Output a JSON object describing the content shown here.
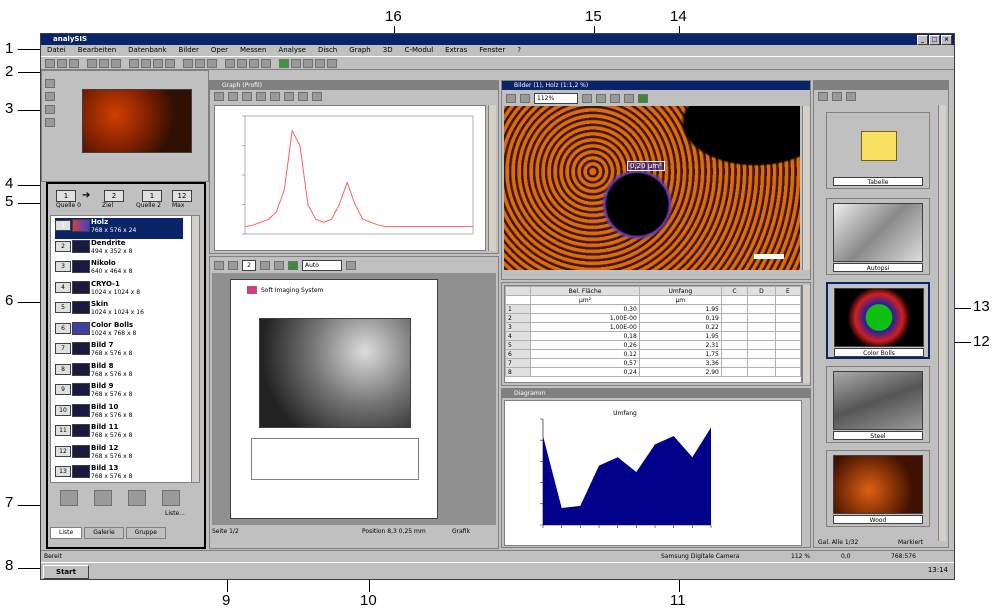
{
  "app": {
    "title": "analySIS"
  },
  "menu": [
    "Datei",
    "Bearbeiten",
    "Datenbank",
    "Bilder",
    "Oper",
    "Messen",
    "Analyse",
    "Disch",
    "Graph",
    "3D",
    "C-Modul",
    "Extras",
    "Fenster",
    "?"
  ],
  "graph_window": {
    "title": "Graph (Profil)"
  },
  "image_window": {
    "title": "Bilder (1), Holz (1:1,2 %)",
    "zoom": "112%",
    "measure_label": "0,20 µm²"
  },
  "report_window": {
    "page_field": "2",
    "zoom_select": "Auto"
  },
  "diagram_window": {
    "title": "Diagramm",
    "chart_title": "Umfang"
  },
  "table": {
    "headers": [
      "",
      "Bel. Fläche",
      "Umfang",
      "C",
      "D",
      "E"
    ],
    "units": [
      "",
      "µm²",
      "µm",
      "",
      "",
      ""
    ],
    "rows": [
      [
        "1",
        "0,30",
        "1,95"
      ],
      [
        "2",
        "1,00E-00",
        "0,19"
      ],
      [
        "3",
        "1,00E-00",
        "0,22"
      ],
      [
        "4",
        "0,18",
        "1,95"
      ],
      [
        "5",
        "0,26",
        "2,31"
      ],
      [
        "6",
        "0,12",
        "1,75"
      ],
      [
        "7",
        "0,57",
        "3,36"
      ],
      [
        "8",
        "0,24",
        "2,90"
      ]
    ]
  },
  "image_list": {
    "tabs": [
      "Liste",
      "Galerie",
      "Gruppe"
    ],
    "items": [
      {
        "num": "1",
        "name": "Holz",
        "dims": "768 x 576 x 24"
      },
      {
        "num": "2",
        "name": "Dendrite",
        "dims": "494 x 352 x 8"
      },
      {
        "num": "3",
        "name": "Nikolo",
        "dims": "640 x 464 x 8"
      },
      {
        "num": "4",
        "name": "CRYO-1",
        "dims": "1024 x 1024 x 8"
      },
      {
        "num": "5",
        "name": "Skin",
        "dims": "1024 x 1024 x 16"
      },
      {
        "num": "6",
        "name": "Color Bolls",
        "dims": "1024 x 768 x 8"
      },
      {
        "num": "7",
        "name": "Bild 7",
        "dims": "768 x 576 x 8"
      },
      {
        "num": "8",
        "name": "Bild 8",
        "dims": "768 x 576 x 8"
      },
      {
        "num": "9",
        "name": "Bild 9",
        "dims": "768 x 576 x 8"
      },
      {
        "num": "10",
        "name": "Bild 10",
        "dims": "768 x 576 x 8"
      },
      {
        "num": "11",
        "name": "Bild 11",
        "dims": "768 x 576 x 8"
      },
      {
        "num": "12",
        "name": "Bild 12",
        "dims": "768 x 576 x 8"
      },
      {
        "num": "13",
        "name": "Bild 13",
        "dims": "768 x 576 x 8"
      }
    ],
    "nav": [
      "1",
      "2",
      "1",
      "12"
    ],
    "nav_labels": [
      "Quelle 0",
      "Ziel",
      "Quelle 2",
      "Max"
    ],
    "button_label": "Liste..."
  },
  "gallery": {
    "items": [
      {
        "label": "Tabelle"
      },
      {
        "label": "Autopsi"
      },
      {
        "label": "Color Bolls"
      },
      {
        "label": "Steel"
      },
      {
        "label": "Wood"
      }
    ],
    "footer_left": "Gal. Alle 1/32",
    "footer_right": "Markiert"
  },
  "report": {
    "company": "Soft Imaging System"
  },
  "status": {
    "left": "Bereit",
    "page": "Seite 1/2",
    "position": "Position 8,3 0,25 mm",
    "mode": "Grafik",
    "camera": "Samsung Digitale Camera",
    "zoom": "112 %",
    "coord": "0,0",
    "size": "768:576",
    "time": "13:14"
  },
  "taskbar": {
    "start": "Start"
  },
  "callouts": [
    "1",
    "2",
    "3",
    "4",
    "5",
    "6",
    "7",
    "8",
    "9",
    "10",
    "11",
    "12",
    "13",
    "14",
    "15",
    "16"
  ],
  "colors": {
    "titlebar": "#0a246a",
    "face": "#c0c0c0",
    "chart_fill": "#00008b",
    "plot_line": "#ff6060"
  },
  "chart_data": [
    {
      "type": "line",
      "title": "",
      "x": [
        0,
        1,
        2,
        3,
        4,
        5,
        6,
        7,
        8,
        9,
        10,
        11,
        12,
        13,
        14,
        15,
        16,
        17,
        18,
        19,
        20,
        21,
        22,
        23,
        24,
        25,
        26,
        27,
        28,
        29
      ],
      "series": [
        {
          "values": [
            0.5,
            0.6,
            0.8,
            1,
            1.5,
            3,
            7,
            6,
            2,
            1,
            0.8,
            1,
            2,
            3.5,
            2,
            1,
            0.8,
            0.6,
            0.5,
            0.5,
            0.5,
            0.5,
            0.5,
            0.5,
            0.5,
            0.5,
            0.5,
            0.5,
            0.5,
            0.5
          ]
        }
      ],
      "ylim": [
        0,
        8
      ]
    },
    {
      "type": "area",
      "title": "Umfang",
      "x": [
        0,
        1,
        2,
        3,
        4,
        5,
        6,
        7,
        8,
        9
      ],
      "series": [
        {
          "values": [
            4.2,
            0.8,
            0.9,
            2.8,
            3.2,
            2.5,
            3.8,
            4.2,
            3.2,
            4.6
          ]
        }
      ],
      "ylim": [
        0,
        5
      ]
    }
  ]
}
